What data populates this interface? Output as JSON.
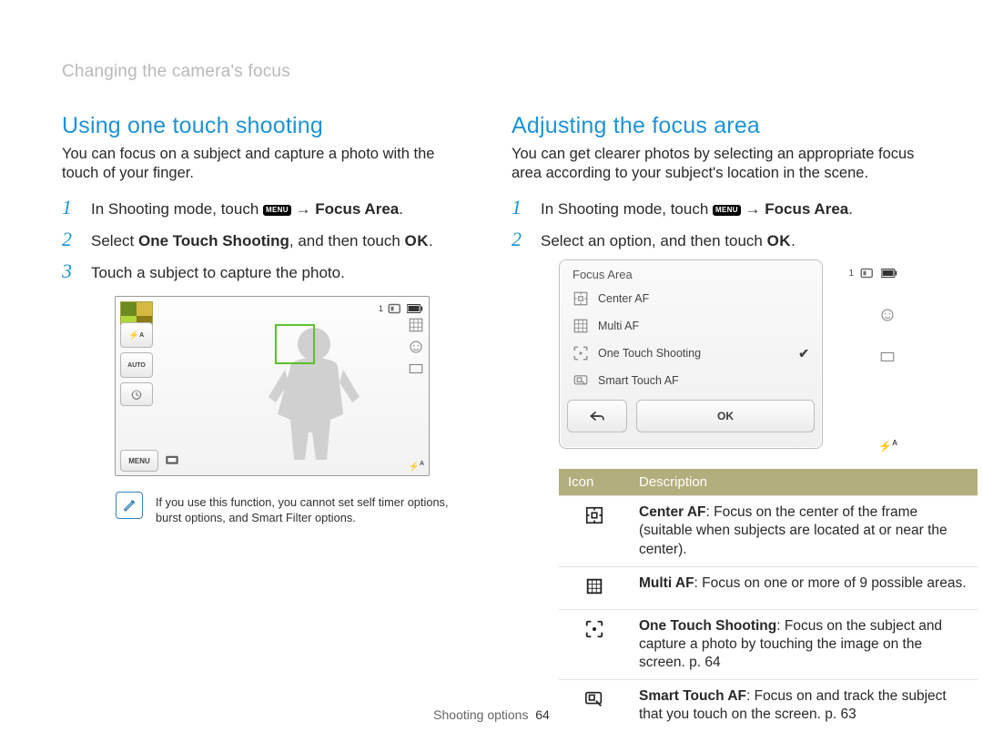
{
  "breadcrumb": "Changing the camera's focus",
  "left": {
    "heading": "Using one touch shooting",
    "lead": "You can focus on a subject and capture a photo with the touch of your finger.",
    "steps": {
      "s1_pre": "In Shooting mode, touch ",
      "s1_menu": "MENU",
      "s1_arrow": " → ",
      "s1_bold": "Focus Area",
      "s1_tail": ".",
      "s2_pre": "Select ",
      "s2_bold": "One Touch Shooting",
      "s2_mid": ", and then touch ",
      "s2_ok": "OK",
      "s2_tail": ".",
      "s3": "Touch a subject to capture the photo."
    },
    "shot": {
      "counter": "1",
      "menu_label": "MENU",
      "flash_auto": "A",
      "flash_prefix": "⚡"
    },
    "note": "If you use this function, you cannot set self timer options, burst options, and Smart Filter options."
  },
  "right": {
    "heading": "Adjusting the focus area",
    "lead": "You can get clearer photos by selecting an appropriate focus area according to your subject's location in the scene.",
    "steps": {
      "s1_pre": "In Shooting mode, touch ",
      "s1_menu": "MENU",
      "s1_arrow": " → ",
      "s1_bold": "Focus Area",
      "s1_tail": ".",
      "s2_pre": "Select an option, and then touch ",
      "s2_ok": "OK",
      "s2_tail": "."
    },
    "dialog": {
      "title": "Focus Area",
      "opts": [
        "Center AF",
        "Multi AF",
        "One Touch Shooting",
        "Smart Touch AF"
      ],
      "checked_index": 2,
      "back": "↩",
      "ok": "OK",
      "counter": "1",
      "flash_auto": "A"
    },
    "table": {
      "head_icon": "Icon",
      "head_desc": "Description",
      "rows": [
        {
          "bold": "Center AF",
          "rest": ": Focus on the center of the frame (suitable when subjects are located at or near the center)."
        },
        {
          "bold": "Multi AF",
          "rest": ": Focus on one or more of 9 possible areas."
        },
        {
          "bold": "One Touch Shooting",
          "rest": ": Focus on the subject and capture a photo by touching the image on the screen. p. 64"
        },
        {
          "bold": "Smart Touch AF",
          "rest": ": Focus on and track the subject that you touch on the screen. p. 63"
        }
      ]
    }
  },
  "footer": {
    "section": "Shooting options",
    "page": "64"
  }
}
